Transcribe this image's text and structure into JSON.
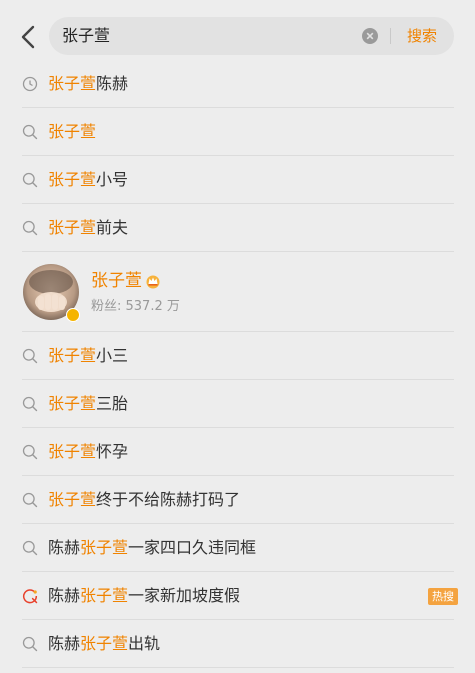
{
  "search": {
    "query": "张子萱",
    "button_label": "搜索"
  },
  "suggestions_before": [
    {
      "icon": "history-icon",
      "highlight": "张子萱",
      "prefix": "",
      "suffix": "陈赫"
    },
    {
      "icon": "search-icon",
      "highlight": "张子萱",
      "prefix": "",
      "suffix": ""
    },
    {
      "icon": "search-icon",
      "highlight": "张子萱",
      "prefix": "",
      "suffix": "小号"
    },
    {
      "icon": "search-icon",
      "highlight": "张子萱",
      "prefix": "",
      "suffix": "前夫"
    }
  ],
  "user": {
    "name": "张子萱",
    "fans_label": "粉丝: 537.2 万"
  },
  "suggestions_after": [
    {
      "icon": "search-icon",
      "highlight": "张子萱",
      "prefix": "",
      "suffix": "小三"
    },
    {
      "icon": "search-icon",
      "highlight": "张子萱",
      "prefix": "",
      "suffix": "三胎"
    },
    {
      "icon": "search-icon",
      "highlight": "张子萱",
      "prefix": "",
      "suffix": "怀孕"
    },
    {
      "icon": "search-icon",
      "highlight": "张子萱",
      "prefix": "",
      "suffix": "终于不给陈赫打码了"
    },
    {
      "icon": "search-icon",
      "highlight": "张子萱",
      "prefix": "陈赫",
      "suffix": "一家四口久违同框"
    },
    {
      "icon": "hot-search-icon",
      "highlight": "张子萱",
      "prefix": "陈赫",
      "suffix": "一家新加坡度假",
      "badge": "热搜"
    },
    {
      "icon": "search-icon",
      "highlight": "张子萱",
      "prefix": "陈赫",
      "suffix": "出轨"
    }
  ],
  "colors": {
    "accent": "#f08300",
    "background": "#ededed",
    "badge": "#f4a340"
  }
}
